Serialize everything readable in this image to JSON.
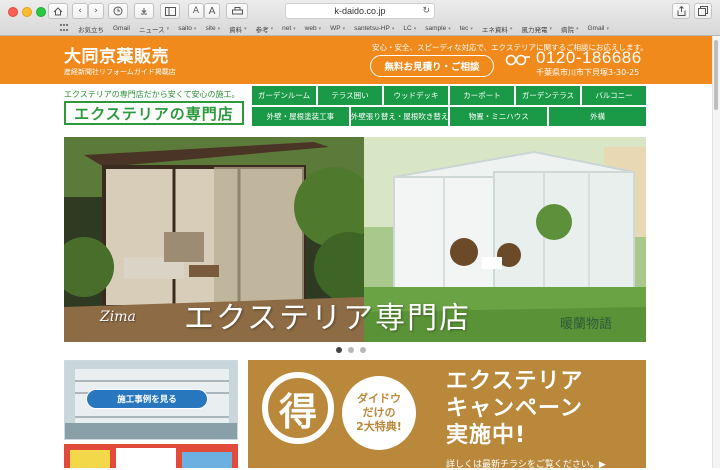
{
  "browser": {
    "url": "k-daido.co.jp",
    "font_size_small": "A",
    "font_size_large": "A",
    "bookmarks": [
      "お気立ち",
      "Gmail",
      "ニュース",
      "saito",
      "site",
      "資料",
      "参考",
      "net",
      "web",
      "WP",
      "santetsu-HP",
      "LC",
      "sample",
      "tec",
      "エネ資料",
      "風力発電",
      "病院",
      "Gmail"
    ]
  },
  "header": {
    "title": "大同京葉販売",
    "subtitle": "産経新聞社リフォームガイド掲載店",
    "message": "安心・安全、スピーディな対応で、エクステリアに関するご相談にお応えします。",
    "estimate_button": "無料お見積り・ご相談",
    "phone": "0120-186686",
    "address": "千葉県市川市下貝塚3-30-25"
  },
  "brand": {
    "tagline": "エクステリアの専門店だから安くて安心の施工。",
    "name": "エクステリアの専門店"
  },
  "nav": {
    "row1": [
      "ガーデンルーム",
      "テラス囲い",
      "ウッドデッキ",
      "カーポート",
      "ガーデンテラス",
      "バルコニー"
    ],
    "row2": [
      "外壁・屋根塗装工事",
      "外壁張り替え・屋根吹き替え",
      "物置・ミニハウス",
      "外構"
    ]
  },
  "hero": {
    "title": "エクステリア専門店",
    "brand_left": "Zima",
    "brand_right": "暖蘭物語"
  },
  "side": {
    "case_button": "施工事例を見る"
  },
  "campaign": {
    "toku": "得",
    "daido_lines": [
      "ダイドウ",
      "だけの",
      "2大特典!"
    ],
    "title_lines": [
      "エクステリア",
      "キャンペーン",
      "実施中!"
    ],
    "footnote": "詳しくは最新チラシをご覧ください。▶"
  },
  "colors": {
    "orange": "#f08a1c",
    "green": "#1a9a46",
    "campaign_brown": "#b9883a",
    "case_blue": "#2876be"
  }
}
